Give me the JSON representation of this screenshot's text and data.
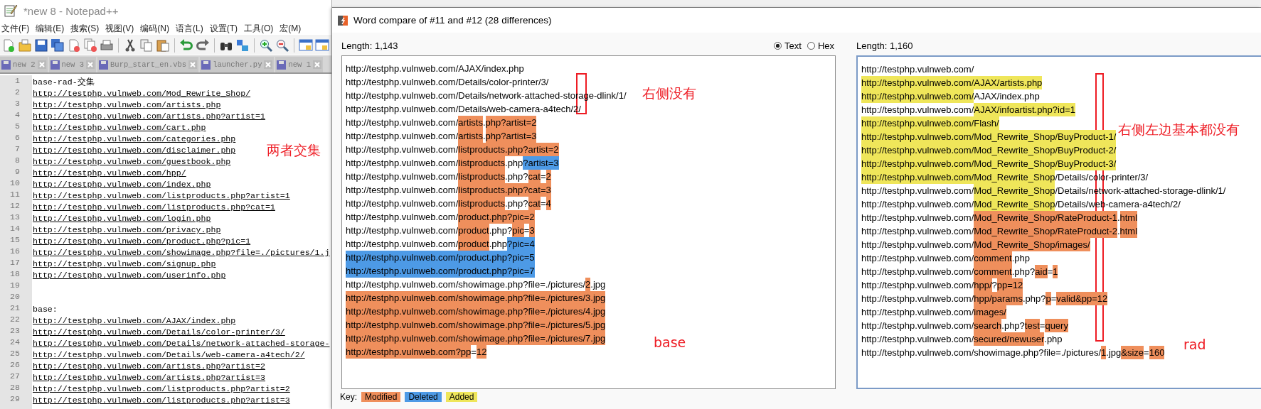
{
  "notepad": {
    "title": "*new 8 - Notepad++",
    "menu": [
      "文件(F)",
      "编辑(E)",
      "搜索(S)",
      "视图(V)",
      "编码(N)",
      "语言(L)",
      "设置(T)",
      "工具(O)",
      "宏(M)"
    ],
    "tabs": [
      {
        "label": "new 2",
        "selected": false
      },
      {
        "label": "new 3",
        "selected": false
      },
      {
        "label": "Burp_start_en.vbs",
        "selected": false
      },
      {
        "label": "launcher.py",
        "selected": false
      },
      {
        "label": "new 1",
        "selected": false
      }
    ],
    "lines": [
      {
        "number": "1",
        "kind": "text",
        "text": "base-rad-交集"
      },
      {
        "number": "2",
        "kind": "url",
        "text": "http://testphp.vulnweb.com/Mod_Rewrite_Shop/"
      },
      {
        "number": "3",
        "kind": "url",
        "text": "http://testphp.vulnweb.com/artists.php"
      },
      {
        "number": "4",
        "kind": "url",
        "text": "http://testphp.vulnweb.com/artists.php?artist=1"
      },
      {
        "number": "5",
        "kind": "url",
        "text": "http://testphp.vulnweb.com/cart.php"
      },
      {
        "number": "6",
        "kind": "url",
        "text": "http://testphp.vulnweb.com/categories.php"
      },
      {
        "number": "7",
        "kind": "url",
        "text": "http://testphp.vulnweb.com/disclaimer.php"
      },
      {
        "number": "8",
        "kind": "url",
        "text": "http://testphp.vulnweb.com/guestbook.php"
      },
      {
        "number": "9",
        "kind": "url",
        "text": "http://testphp.vulnweb.com/hpp/"
      },
      {
        "number": "10",
        "kind": "url",
        "text": "http://testphp.vulnweb.com/index.php"
      },
      {
        "number": "11",
        "kind": "url",
        "text": "http://testphp.vulnweb.com/listproducts.php?artist=1"
      },
      {
        "number": "12",
        "kind": "url",
        "text": "http://testphp.vulnweb.com/listproducts.php?cat=1"
      },
      {
        "number": "13",
        "kind": "url",
        "text": "http://testphp.vulnweb.com/login.php"
      },
      {
        "number": "14",
        "kind": "url",
        "text": "http://testphp.vulnweb.com/privacy.php"
      },
      {
        "number": "15",
        "kind": "url",
        "text": "http://testphp.vulnweb.com/product.php?pic=1"
      },
      {
        "number": "16",
        "kind": "url",
        "text": "http://testphp.vulnweb.com/showimage.php?file=./pictures/1.j"
      },
      {
        "number": "17",
        "kind": "url",
        "text": "http://testphp.vulnweb.com/signup.php"
      },
      {
        "number": "18",
        "kind": "url",
        "text": "http://testphp.vulnweb.com/userinfo.php"
      },
      {
        "number": "19",
        "kind": "text"
      },
      {
        "number": "20",
        "kind": "text"
      },
      {
        "number": "21",
        "kind": "text",
        "text": "base:"
      },
      {
        "number": "22",
        "kind": "url",
        "text": "http://testphp.vulnweb.com/AJAX/index.php"
      },
      {
        "number": "23",
        "kind": "url",
        "text": "http://testphp.vulnweb.com/Details/color-printer/3/"
      },
      {
        "number": "24",
        "kind": "url",
        "text": "http://testphp.vulnweb.com/Details/network-attached-storage-"
      },
      {
        "number": "25",
        "kind": "url",
        "text": "http://testphp.vulnweb.com/Details/web-camera-a4tech/2/"
      },
      {
        "number": "26",
        "kind": "url",
        "text": "http://testphp.vulnweb.com/artists.php?artist=2"
      },
      {
        "number": "27",
        "kind": "url",
        "text": "http://testphp.vulnweb.com/artists.php?artist=3"
      },
      {
        "number": "28",
        "kind": "url",
        "text": "http://testphp.vulnweb.com/listproducts.php?artist=2"
      },
      {
        "number": "29",
        "kind": "url",
        "text": "http://testphp.vulnweb.com/listproducts.php?artist=3"
      }
    ],
    "annotation": "两者交集"
  },
  "compare": {
    "title": "Word compare of #11 and #12  (28 differences)",
    "modes": [
      {
        "label": "Text",
        "selected": true
      },
      {
        "label": "Hex",
        "selected": false
      }
    ],
    "left": {
      "length": "Length: 1,143",
      "lines": [
        [
          {
            "kind": "plain",
            "text": "http://testphp.vulnweb.com/AJAX/index.php"
          }
        ],
        [
          {
            "kind": "plain",
            "text": "http://testphp.vulnweb.com/Details/color-printer/3/"
          }
        ],
        [
          {
            "kind": "plain",
            "text": "http://testphp.vulnweb.com/Details/network-attached-storage-dlink/1/"
          }
        ],
        [
          {
            "kind": "plain",
            "text": "http://testphp.vulnweb.com/Details/web-camera-a4tech/2/"
          }
        ],
        [
          {
            "kind": "plain",
            "text": "http://testphp.vulnweb.com/"
          },
          {
            "kind": "modified",
            "text": "artists"
          },
          {
            "kind": "plain",
            "text": "."
          },
          {
            "kind": "modified",
            "text": "php?artist=2"
          }
        ],
        [
          {
            "kind": "plain",
            "text": "http://testphp.vulnweb.com/"
          },
          {
            "kind": "modified",
            "text": "artists"
          },
          {
            "kind": "plain",
            "text": "."
          },
          {
            "kind": "modified",
            "text": "php?artist=3"
          }
        ],
        [
          {
            "kind": "plain",
            "text": "http://testphp.vulnweb.com/"
          },
          {
            "kind": "modified",
            "text": "listproducts.php?artist=2"
          }
        ],
        [
          {
            "kind": "plain",
            "text": "http://testphp.vulnweb.com/"
          },
          {
            "kind": "modified",
            "text": "listproducts"
          },
          {
            "kind": "plain",
            "text": ".php"
          },
          {
            "kind": "deleted",
            "text": "?artist=3"
          }
        ],
        [
          {
            "kind": "plain",
            "text": "http://testphp.vulnweb.com/"
          },
          {
            "kind": "modified",
            "text": "listproducts"
          },
          {
            "kind": "plain",
            "text": ".php?"
          },
          {
            "kind": "modified",
            "text": "cat"
          },
          {
            "kind": "plain",
            "text": "="
          },
          {
            "kind": "modified",
            "text": "2"
          }
        ],
        [
          {
            "kind": "plain",
            "text": "http://testphp.vulnweb.com/"
          },
          {
            "kind": "modified",
            "text": "listproducts.php?cat=3"
          }
        ],
        [
          {
            "kind": "plain",
            "text": "http://testphp.vulnweb.com/"
          },
          {
            "kind": "modified",
            "text": "listproducts"
          },
          {
            "kind": "plain",
            "text": ".php?"
          },
          {
            "kind": "modified",
            "text": "cat"
          },
          {
            "kind": "plain",
            "text": "="
          },
          {
            "kind": "modified",
            "text": "4"
          }
        ],
        [
          {
            "kind": "plain",
            "text": "http://testphp.vulnweb.com/"
          },
          {
            "kind": "modified",
            "text": "product.php?pic=2"
          }
        ],
        [
          {
            "kind": "plain",
            "text": "http://testphp.vulnweb.com/"
          },
          {
            "kind": "modified",
            "text": "product"
          },
          {
            "kind": "plain",
            "text": ".php?"
          },
          {
            "kind": "modified",
            "text": "pic"
          },
          {
            "kind": "plain",
            "text": "="
          },
          {
            "kind": "modified",
            "text": "3"
          }
        ],
        [
          {
            "kind": "plain",
            "text": "http://testphp.vulnweb.com/"
          },
          {
            "kind": "modified",
            "text": "product"
          },
          {
            "kind": "plain",
            "text": ".php"
          },
          {
            "kind": "deleted",
            "text": "?pic=4"
          }
        ],
        [
          {
            "kind": "deleted",
            "text": "http://testphp.vulnweb.com/product.php?pic=5"
          }
        ],
        [
          {
            "kind": "deleted",
            "text": "http://testphp.vulnweb.com/product.php?pic=7"
          }
        ],
        [
          {
            "kind": "plain",
            "text": "http://testphp.vulnweb.com/showimage.php?file=./pictures/"
          },
          {
            "kind": "modified",
            "text": "2"
          },
          {
            "kind": "plain",
            "text": ".jpg"
          }
        ],
        [
          {
            "kind": "modified",
            "text": "http://testphp.vulnweb.com/showimage.php?file=./pictures/3.jpg"
          }
        ],
        [
          {
            "kind": "modified",
            "text": "http://testphp.vulnweb.com/showimage.php?file=./pictures/4.jpg"
          }
        ],
        [
          {
            "kind": "modified",
            "text": "http://testphp.vulnweb.com/showimage.php?file=./pictures/5.jpg"
          }
        ],
        [
          {
            "kind": "modified",
            "text": "http://testphp.vulnweb.com/showimage.php?file=./pictures/7.jpg"
          }
        ],
        [
          {
            "kind": "modified",
            "text": "http://testphp.vulnweb.com?pp"
          },
          {
            "kind": "plain",
            "text": "="
          },
          {
            "kind": "modified",
            "text": "12"
          }
        ]
      ]
    },
    "right": {
      "length": "Length: 1,160",
      "lines": [
        [
          {
            "kind": "plain",
            "text": "http://testphp.vulnweb.com/"
          }
        ],
        [
          {
            "kind": "added",
            "text": "http://testphp.vulnweb.com/AJAX/artists.php"
          }
        ],
        [
          {
            "kind": "added",
            "text": "http://testphp.vulnweb.com/"
          },
          {
            "kind": "plain",
            "text": "AJAX/index.php"
          }
        ],
        [
          {
            "kind": "plain",
            "text": "http://testphp.vulnweb.com/"
          },
          {
            "kind": "added",
            "text": "AJAX/infoartist.php?id=1"
          }
        ],
        [
          {
            "kind": "added",
            "text": "http://testphp.vulnweb.com/Flash/"
          }
        ],
        [
          {
            "kind": "added",
            "text": "http://testphp.vulnweb.com/Mod_Rewrite_Shop/BuyProduct-1/"
          }
        ],
        [
          {
            "kind": "added",
            "text": "http://testphp.vulnweb.com/Mod_Rewrite_Shop/BuyProduct-2/"
          }
        ],
        [
          {
            "kind": "added",
            "text": "http://testphp.vulnweb.com/Mod_Rewrite_Shop/BuyProduct-3/"
          }
        ],
        [
          {
            "kind": "added",
            "text": "http://testphp.vulnweb.com/Mod_Rewrite_Shop"
          },
          {
            "kind": "plain",
            "text": "/Details/color-printer/3/"
          }
        ],
        [
          {
            "kind": "plain",
            "text": "http://testphp.vulnweb.com/"
          },
          {
            "kind": "added",
            "text": "Mod_Rewrite_Shop"
          },
          {
            "kind": "plain",
            "text": "/Details/network-attached-storage-dlink/1/"
          }
        ],
        [
          {
            "kind": "plain",
            "text": "http://testphp.vulnweb.com/"
          },
          {
            "kind": "added",
            "text": "Mod_Rewrite_Shop"
          },
          {
            "kind": "plain",
            "text": "/Details/web-camera-a4tech/2/"
          }
        ],
        [
          {
            "kind": "plain",
            "text": "http://testphp.vulnweb.com/"
          },
          {
            "kind": "modified",
            "text": "Mod_Rewrite_Shop/RateProduct-1"
          },
          {
            "kind": "plain",
            "text": "."
          },
          {
            "kind": "modified",
            "text": "html"
          }
        ],
        [
          {
            "kind": "plain",
            "text": "http://testphp.vulnweb.com/"
          },
          {
            "kind": "modified",
            "text": "Mod_Rewrite_Shop/RateProduct-2"
          },
          {
            "kind": "plain",
            "text": "."
          },
          {
            "kind": "modified",
            "text": "html"
          }
        ],
        [
          {
            "kind": "plain",
            "text": "http://testphp.vulnweb.com/"
          },
          {
            "kind": "modified",
            "text": "Mod_Rewrite_Shop/images/"
          }
        ],
        [
          {
            "kind": "plain",
            "text": "http://testphp.vulnweb.com/"
          },
          {
            "kind": "modified",
            "text": "comment"
          },
          {
            "kind": "plain",
            "text": ".php"
          }
        ],
        [
          {
            "kind": "plain",
            "text": "http://testphp.vulnweb.com/"
          },
          {
            "kind": "modified",
            "text": "comment"
          },
          {
            "kind": "plain",
            "text": ".php?"
          },
          {
            "kind": "modified",
            "text": "aid"
          },
          {
            "kind": "plain",
            "text": "="
          },
          {
            "kind": "modified",
            "text": "1"
          }
        ],
        [
          {
            "kind": "plain",
            "text": "http://testphp.vulnweb.com/"
          },
          {
            "kind": "modified",
            "text": "hpp/"
          },
          {
            "kind": "plain",
            "text": "?"
          },
          {
            "kind": "modified",
            "text": "pp=12"
          }
        ],
        [
          {
            "kind": "plain",
            "text": "http://testphp.vulnweb.com/"
          },
          {
            "kind": "modified",
            "text": "hpp/params"
          },
          {
            "kind": "plain",
            "text": ".php?"
          },
          {
            "kind": "modified",
            "text": "p"
          },
          {
            "kind": "plain",
            "text": "="
          },
          {
            "kind": "modified",
            "text": "valid&pp=12"
          }
        ],
        [
          {
            "kind": "plain",
            "text": "http://testphp.vulnweb.com/"
          },
          {
            "kind": "modified",
            "text": "images/"
          }
        ],
        [
          {
            "kind": "plain",
            "text": "http://testphp.vulnweb.com/"
          },
          {
            "kind": "modified",
            "text": "search"
          },
          {
            "kind": "plain",
            "text": ".php?"
          },
          {
            "kind": "modified",
            "text": "test"
          },
          {
            "kind": "plain",
            "text": "="
          },
          {
            "kind": "modified",
            "text": "query"
          }
        ],
        [
          {
            "kind": "plain",
            "text": "http://testphp.vulnweb.com/"
          },
          {
            "kind": "modified",
            "text": "secured/newuser"
          },
          {
            "kind": "plain",
            "text": ".php"
          }
        ],
        [
          {
            "kind": "plain",
            "text": "http://testphp.vulnweb.com/showimage.php?file=./pictures/"
          },
          {
            "kind": "modified",
            "text": "1"
          },
          {
            "kind": "plain",
            "text": ".jpg"
          },
          {
            "kind": "modified",
            "text": "&size"
          },
          {
            "kind": "plain",
            "text": "="
          },
          {
            "kind": "modified",
            "text": "160"
          }
        ]
      ]
    },
    "key": {
      "label": "Key:",
      "items": [
        {
          "kind": "modified",
          "label": "Modified"
        },
        {
          "kind": "deleted",
          "label": "Deleted"
        },
        {
          "kind": "added",
          "label": "Added"
        }
      ]
    },
    "annotations": [
      {
        "kind": "box"
      },
      {
        "kind": "label",
        "text": "右侧没有"
      },
      {
        "kind": "label",
        "text": "base"
      },
      {
        "kind": "box"
      },
      {
        "kind": "label",
        "text": "右侧左边基本都没有"
      },
      {
        "kind": "label",
        "text": "rad"
      }
    ]
  }
}
